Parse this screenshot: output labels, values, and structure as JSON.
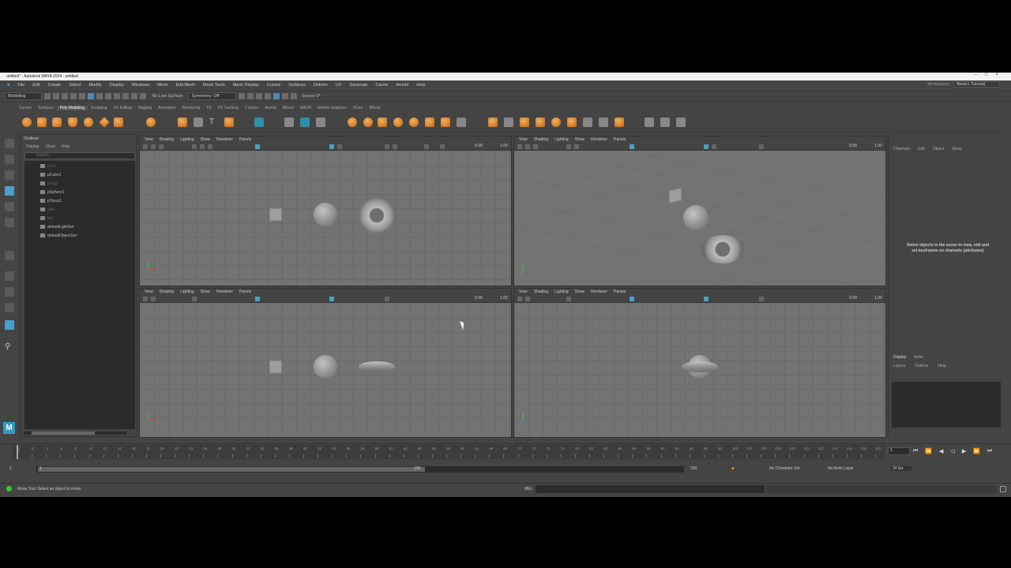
{
  "window": {
    "title": "untitled* - Autodesk MAYA 2024 - untitled"
  },
  "menubar": [
    "File",
    "Edit",
    "Create",
    "Select",
    "Modify",
    "Display",
    "Windows",
    "Mesh",
    "Edit Mesh",
    "Mesh Tools",
    "Mesh Display",
    "Curves",
    "Surfaces",
    "Deform",
    "UV",
    "Generate",
    "Cache",
    "Arnold",
    "Help"
  ],
  "workspace": {
    "label": "Workspace:",
    "value": "Basics Tutorial"
  },
  "statusline": {
    "mode": "Modeling",
    "live_surface": "No Live Surface",
    "symmetry": "Symmetry: Off",
    "signin": "bexcor 0*"
  },
  "shelf_tabs": [
    "Curves",
    "Surfaces",
    "Poly Modeling",
    "Sculpting",
    "UV Editing",
    "Rigging",
    "Animation",
    "Rendering",
    "FX",
    "FX Caching",
    "Custom",
    "Arnold",
    "Bifrost",
    "MASH",
    "Motion Graphics",
    "XGen",
    "Bifrost"
  ],
  "shelf_active": "Poly Modeling",
  "outliner": {
    "title": "Outliner",
    "menu": [
      "Display",
      "Show",
      "Help"
    ],
    "search_placeholder": "Search...",
    "items": [
      {
        "label": "front",
        "dim": true
      },
      {
        "label": "pCube1",
        "dim": false
      },
      {
        "label": "persp",
        "dim": true
      },
      {
        "label": "pSphere1",
        "dim": false
      },
      {
        "label": "pTorus1",
        "dim": false
      },
      {
        "label": "side",
        "dim": true
      },
      {
        "label": "top",
        "dim": true
      },
      {
        "label": "defaultLightSet",
        "dim": false
      },
      {
        "label": "defaultObjectSet",
        "dim": false
      }
    ]
  },
  "viewport_menu": [
    "View",
    "Shading",
    "Lighting",
    "Show",
    "Renderer",
    "Panels"
  ],
  "viewport_values": {
    "exposure": "0.00",
    "gamma": "1.00"
  },
  "channelbox": {
    "menu": [
      "Channels",
      "Edit",
      "Object",
      "Show"
    ],
    "message": "Select objects in the scene to view, edit and set keyframes on channels (attributes)",
    "layer_tabs": [
      "Display",
      "Anim"
    ],
    "layer_menu": [
      "Layers",
      "Options",
      "Help"
    ]
  },
  "timeline": {
    "ticks": [
      "1",
      "2",
      "4",
      "6",
      "8",
      "10",
      "12",
      "14",
      "16",
      "18",
      "20",
      "22",
      "24",
      "26",
      "28",
      "30",
      "32",
      "34",
      "36",
      "38",
      "40",
      "42",
      "44",
      "46",
      "48",
      "50",
      "52",
      "54",
      "56",
      "58",
      "60",
      "62",
      "64",
      "66",
      "68",
      "70",
      "72",
      "74",
      "76",
      "78",
      "80",
      "82",
      "84",
      "86",
      "88",
      "90",
      "92",
      "94",
      "96",
      "98",
      "100",
      "102",
      "104",
      "106",
      "108",
      "110",
      "112",
      "114",
      "116",
      "118",
      "120"
    ],
    "current_frame": "1"
  },
  "range": {
    "start": "1",
    "inner_start": "1",
    "inner_end": "120",
    "end": "200",
    "character_set": "No Character Set",
    "anim_layer": "No Anim Layer",
    "fps": "24 fps"
  },
  "helpline": {
    "text": "Move Tool: Select an object to move.",
    "mel_label": "MEL"
  },
  "colors": {
    "accent": "#4c9fc9",
    "orange": "#e08a2a",
    "bg": "#444444",
    "viewport": "#737373"
  }
}
